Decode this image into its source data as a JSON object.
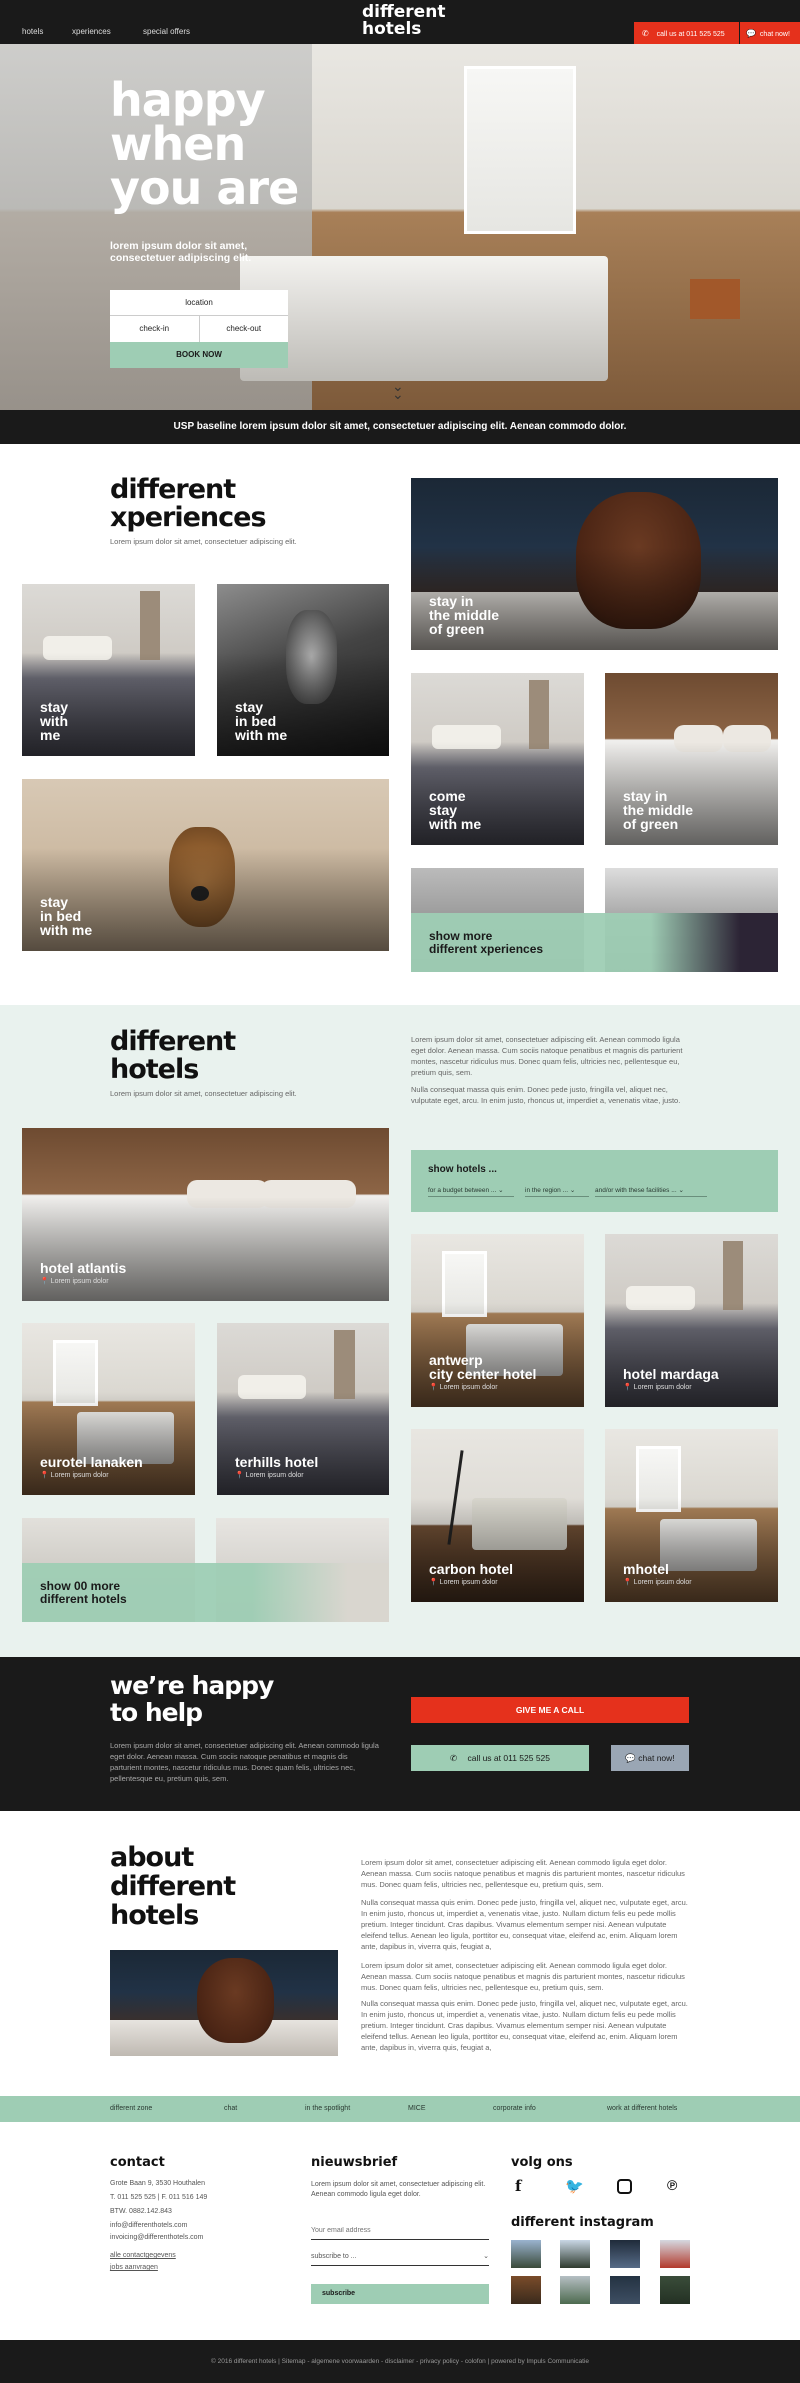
{
  "nav": {
    "items": [
      "hotels",
      "xperiences",
      "special offers"
    ],
    "logo_line1": "different",
    "logo_line2": "hotels",
    "call_label": "call us at 011 525 525",
    "chat_label": "chat now!"
  },
  "hero": {
    "headline_1": "happy",
    "headline_2": "when",
    "headline_3": "you are",
    "tagline_1": "lorem ipsum dolor sit amet,",
    "tagline_2": "consectetuer adipiscing elit.",
    "location_label": "location",
    "checkin_label": "check-in",
    "checkout_label": "check-out",
    "book_label": "BOOK NOW"
  },
  "usp": "USP baseline lorem ipsum dolor sit amet, consectetuer adipiscing elit. Aenean commodo dolor.",
  "xperiences": {
    "title_1": "different",
    "title_2": "xperiences",
    "intro": "Lorem ipsum dolor sit amet, consectetuer adipiscing elit.",
    "tiles": [
      {
        "l1": "stay",
        "l2": "with",
        "l3": "me"
      },
      {
        "l1": "stay",
        "l2": "in bed",
        "l3": "with me"
      },
      {
        "l1": "stay",
        "l2": "in bed",
        "l3": "with me"
      },
      {
        "l1": "stay in",
        "l2": "the middle",
        "l3": "of green"
      },
      {
        "l1": "come",
        "l2": "stay",
        "l3": "with me"
      },
      {
        "l1": "stay in",
        "l2": "the middle",
        "l3": "of green"
      }
    ],
    "more_1": "show more",
    "more_2": "different xperiences"
  },
  "hotels": {
    "title_1": "different",
    "title_2": "hotels",
    "intro": "Lorem ipsum dolor sit amet, consectetuer adipiscing elit.",
    "para_1": "Lorem ipsum dolor sit amet, consectetuer adipiscing elit. Aenean commodo ligula eget dolor. Aenean massa. Cum sociis natoque penatibus et magnis dis parturient montes, nascetur ridiculus mus. Donec quam felis, ultricies nec, pellentesque eu, pretium quis, sem.",
    "para_2": "Nulla consequat massa quis enim. Donec pede justo, fringilla vel, aliquet nec, vulputate eget, arcu. In enim justo, rhoncus ut, imperdiet a, venenatis vitae, justo.",
    "filter_title": "show hotels ...",
    "filter_budget": "for a budget between ...",
    "filter_region": "in the region ...",
    "filter_facilities": "and/or with these facilities ...",
    "location_text": "Lorem ipsum dolor",
    "names": {
      "atlantis": "hotel atlantis",
      "antwerp_1": "antwerp",
      "antwerp_2": "city center hotel",
      "mardaga": "hotel mardaga",
      "eurotel": "eurotel lanaken",
      "terhills": "terhills hotel",
      "carbon": "carbon hotel",
      "mhotel": "mhotel"
    },
    "more_1": "show 00 more",
    "more_2": "different hotels"
  },
  "help": {
    "title_1": "we’re happy",
    "title_2": "to help",
    "text": "Lorem ipsum dolor sit amet, consectetuer adipiscing elit. Aenean commodo ligula eget dolor. Aenean massa. Cum sociis natoque penatibus et magnis dis parturient montes, nascetur ridiculus mus. Donec quam felis, ultricies nec, pellentesque eu, pretium quis, sem.",
    "give_call": "GIVE ME A CALL",
    "call_us": "call us at 011 525 525",
    "chat_now": "chat now!"
  },
  "about": {
    "title_1": "about",
    "title_2": "different",
    "title_3": "hotels",
    "p1": "Lorem ipsum dolor sit amet, consectetuer adipiscing elit. Aenean commodo ligula eget dolor. Aenean massa. Cum sociis natoque penatibus et magnis dis parturient montes, nascetur ridiculus mus. Donec quam felis, ultricies nec, pellentesque eu, pretium quis, sem.",
    "p2": "Nulla consequat massa quis enim. Donec pede justo, fringilla vel, aliquet nec, vulputate eget, arcu. In enim justo, rhoncus ut, imperdiet a, venenatis vitae, justo. Nullam dictum felis eu pede mollis pretium. Integer tincidunt. Cras dapibus. Vivamus elementum semper nisi. Aenean vulputate eleifend tellus. Aenean leo ligula, porttitor eu, consequat vitae, eleifend ac, enim. Aliquam lorem ante, dapibus in, viverra quis, feugiat a,",
    "p3": "Lorem ipsum dolor sit amet, consectetuer adipiscing elit. Aenean commodo ligula eget dolor. Aenean massa. Cum sociis natoque penatibus et magnis dis parturient montes, nascetur ridiculus mus. Donec quam felis, ultricies nec, pellentesque eu, pretium quis, sem.",
    "p4": "Nulla consequat massa quis enim. Donec pede justo, fringilla vel, aliquet nec, vulputate eget, arcu. In enim justo, rhoncus ut, imperdiet a, venenatis vitae, justo. Nullam dictum felis eu pede mollis pretium. Integer tincidunt. Cras dapibus. Vivamus elementum semper nisi. Aenean vulputate eleifend tellus. Aenean leo ligula, porttitor eu, consequat vitae, eleifend ac, enim. Aliquam lorem ante, dapibus in, viverra quis, feugiat a,"
  },
  "subnav": [
    "different zone",
    "chat",
    "in the spotlight",
    "MICE",
    "corporate info",
    "work at different hotels"
  ],
  "footer": {
    "contact_title": "contact",
    "address": "Grote Baan 9, 3530 Houthalen",
    "phone": "T. 011 525 525 | F. 011 516 149",
    "vat": "BTW. 0882.142.843",
    "email_1": "info@differenthotels.com",
    "email_2": "invoicing@differenthotels.com",
    "link_contacts": "alle contactgegevens",
    "link_jobs": "jobs aanvragen",
    "news_title": "nieuwsbrief",
    "news_text": "Lorem ipsum dolor sit amet, consectetuer adipiscing elit. Aenean commodo ligula eget dolor.",
    "email_placeholder": "Your email address",
    "subscribe_to": "subscribe to ...",
    "subscribe_btn": "subscribe",
    "follow_title": "volg ons",
    "insta_title": "different instagram",
    "social": [
      "facebook-icon",
      "twitter-icon",
      "instagram-icon",
      "pinterest-icon"
    ]
  },
  "bottom_line": "© 2016 different hotels | Sitemap - algemene voorwaarden - disclaimer - privacy policy - colofon | powered by Impuls Communicatie",
  "colors": {
    "accent_red": "#e5311c",
    "mint": "#9ecdb4",
    "dark": "#1a1a1a",
    "light_bg": "#e9f2ee"
  }
}
